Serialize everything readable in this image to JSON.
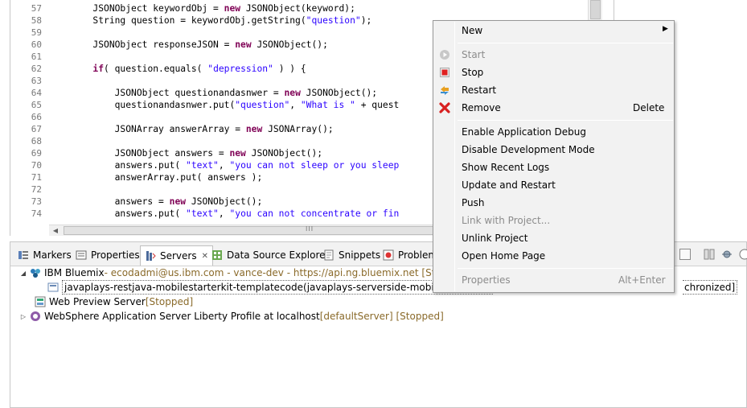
{
  "editor": {
    "line_numbers": [
      "57",
      "58",
      "59",
      "60",
      "61",
      "62",
      "63",
      "64",
      "65",
      "66",
      "67",
      "68",
      "69",
      "70",
      "71",
      "72",
      "73",
      "74"
    ],
    "lines": [
      [
        [
          "t",
          "        JSONObject keywordObj = "
        ],
        [
          "k",
          "new"
        ],
        [
          "t",
          " JSONObject(keyword);"
        ]
      ],
      [
        [
          "t",
          "        String question = keywordObj.getString("
        ],
        [
          "s",
          "\"question\""
        ],
        [
          "t",
          ");"
        ]
      ],
      [],
      [
        [
          "t",
          "        JSONObject responseJSON = "
        ],
        [
          "k",
          "new"
        ],
        [
          "t",
          " JSONObject();"
        ]
      ],
      [],
      [
        [
          "t",
          "        "
        ],
        [
          "k",
          "if"
        ],
        [
          "t",
          "( question.equals( "
        ],
        [
          "s",
          "\"depression\""
        ],
        [
          "t",
          " ) ) {"
        ]
      ],
      [],
      [
        [
          "t",
          "            JSONObject questionandasnwer = "
        ],
        [
          "k",
          "new"
        ],
        [
          "t",
          " JSONObject();"
        ]
      ],
      [
        [
          "t",
          "            questionandasnwer.put("
        ],
        [
          "s",
          "\"question\""
        ],
        [
          "t",
          ", "
        ],
        [
          "s",
          "\"What is \""
        ],
        [
          "t",
          " + quest"
        ]
      ],
      [],
      [
        [
          "t",
          "            JSONArray answerArray = "
        ],
        [
          "k",
          "new"
        ],
        [
          "t",
          " JSONArray();"
        ]
      ],
      [],
      [
        [
          "t",
          "            JSONObject answers = "
        ],
        [
          "k",
          "new"
        ],
        [
          "t",
          " JSONObject();"
        ]
      ],
      [
        [
          "t",
          "            answers.put( "
        ],
        [
          "s",
          "\"text\""
        ],
        [
          "t",
          ", "
        ],
        [
          "s",
          "\"you can not sleep or you sleep"
        ]
      ],
      [
        [
          "t",
          "            answerArray.put( answers );"
        ]
      ],
      [],
      [
        [
          "t",
          "            answers = "
        ],
        [
          "k",
          "new"
        ],
        [
          "t",
          " JSONObject();"
        ]
      ],
      [
        [
          "t",
          "            answers.put( "
        ],
        [
          "s",
          "\"text\""
        ],
        [
          "t",
          ", "
        ],
        [
          "s",
          "\"you can not concentrate or fin"
        ]
      ]
    ],
    "hscroll_grip": "III"
  },
  "tabs": [
    {
      "label": "Markers",
      "icon": "markers-icon"
    },
    {
      "label": "Properties",
      "icon": "properties-icon"
    },
    {
      "label": "Servers",
      "icon": "servers-icon",
      "close": "✕",
      "active": true
    },
    {
      "label": "Data Source Explorer",
      "icon": "data-source-icon"
    },
    {
      "label": "Snippets",
      "icon": "snippets-icon"
    },
    {
      "label": "Problem",
      "icon": "problems-icon"
    }
  ],
  "servers": {
    "bluemix": {
      "expander": "◢",
      "name": "IBM Bluemix",
      "detail": " - ecodadmi@us.ibm.com - vance-dev - https://api.ng.bluemix.net  [Started, S"
    },
    "app": {
      "name": "javaplays-restjava-mobilestarterkit-templatecode(javaplays-serverside-mobilestarterkit-",
      "tail": "chronized]"
    },
    "webpreview": {
      "name": "Web Preview Server",
      "status": "  [Stopped]"
    },
    "liberty": {
      "expander": "▷",
      "name": "WebSphere Application Server Liberty Profile at localhost",
      "detail": "  [defaultServer]  [Stopped]"
    }
  },
  "menu": {
    "new": {
      "label": "New",
      "arrow": "▶"
    },
    "start": {
      "label": "Start"
    },
    "stop": {
      "label": "Stop"
    },
    "restart": {
      "label": "Restart"
    },
    "remove": {
      "label": "Remove",
      "shortcut": "Delete"
    },
    "enable_debug": {
      "label": "Enable Application Debug"
    },
    "disable_dev": {
      "label": "Disable Development Mode"
    },
    "recent_logs": {
      "label": "Show Recent Logs"
    },
    "update_restart": {
      "label": "Update and Restart"
    },
    "push": {
      "label": "Push"
    },
    "link_project": {
      "label": "Link with Project..."
    },
    "unlink_project": {
      "label": "Unlink Project"
    },
    "open_home": {
      "label": "Open Home Page"
    },
    "properties": {
      "label": "Properties",
      "shortcut": "Alt+Enter"
    }
  },
  "colors": {
    "keyword": "#7f0055",
    "string": "#2a00ff",
    "decoration": "#8a6a2a",
    "menu_bg": "#f2f2f2",
    "disabled": "#8c8c8c"
  }
}
